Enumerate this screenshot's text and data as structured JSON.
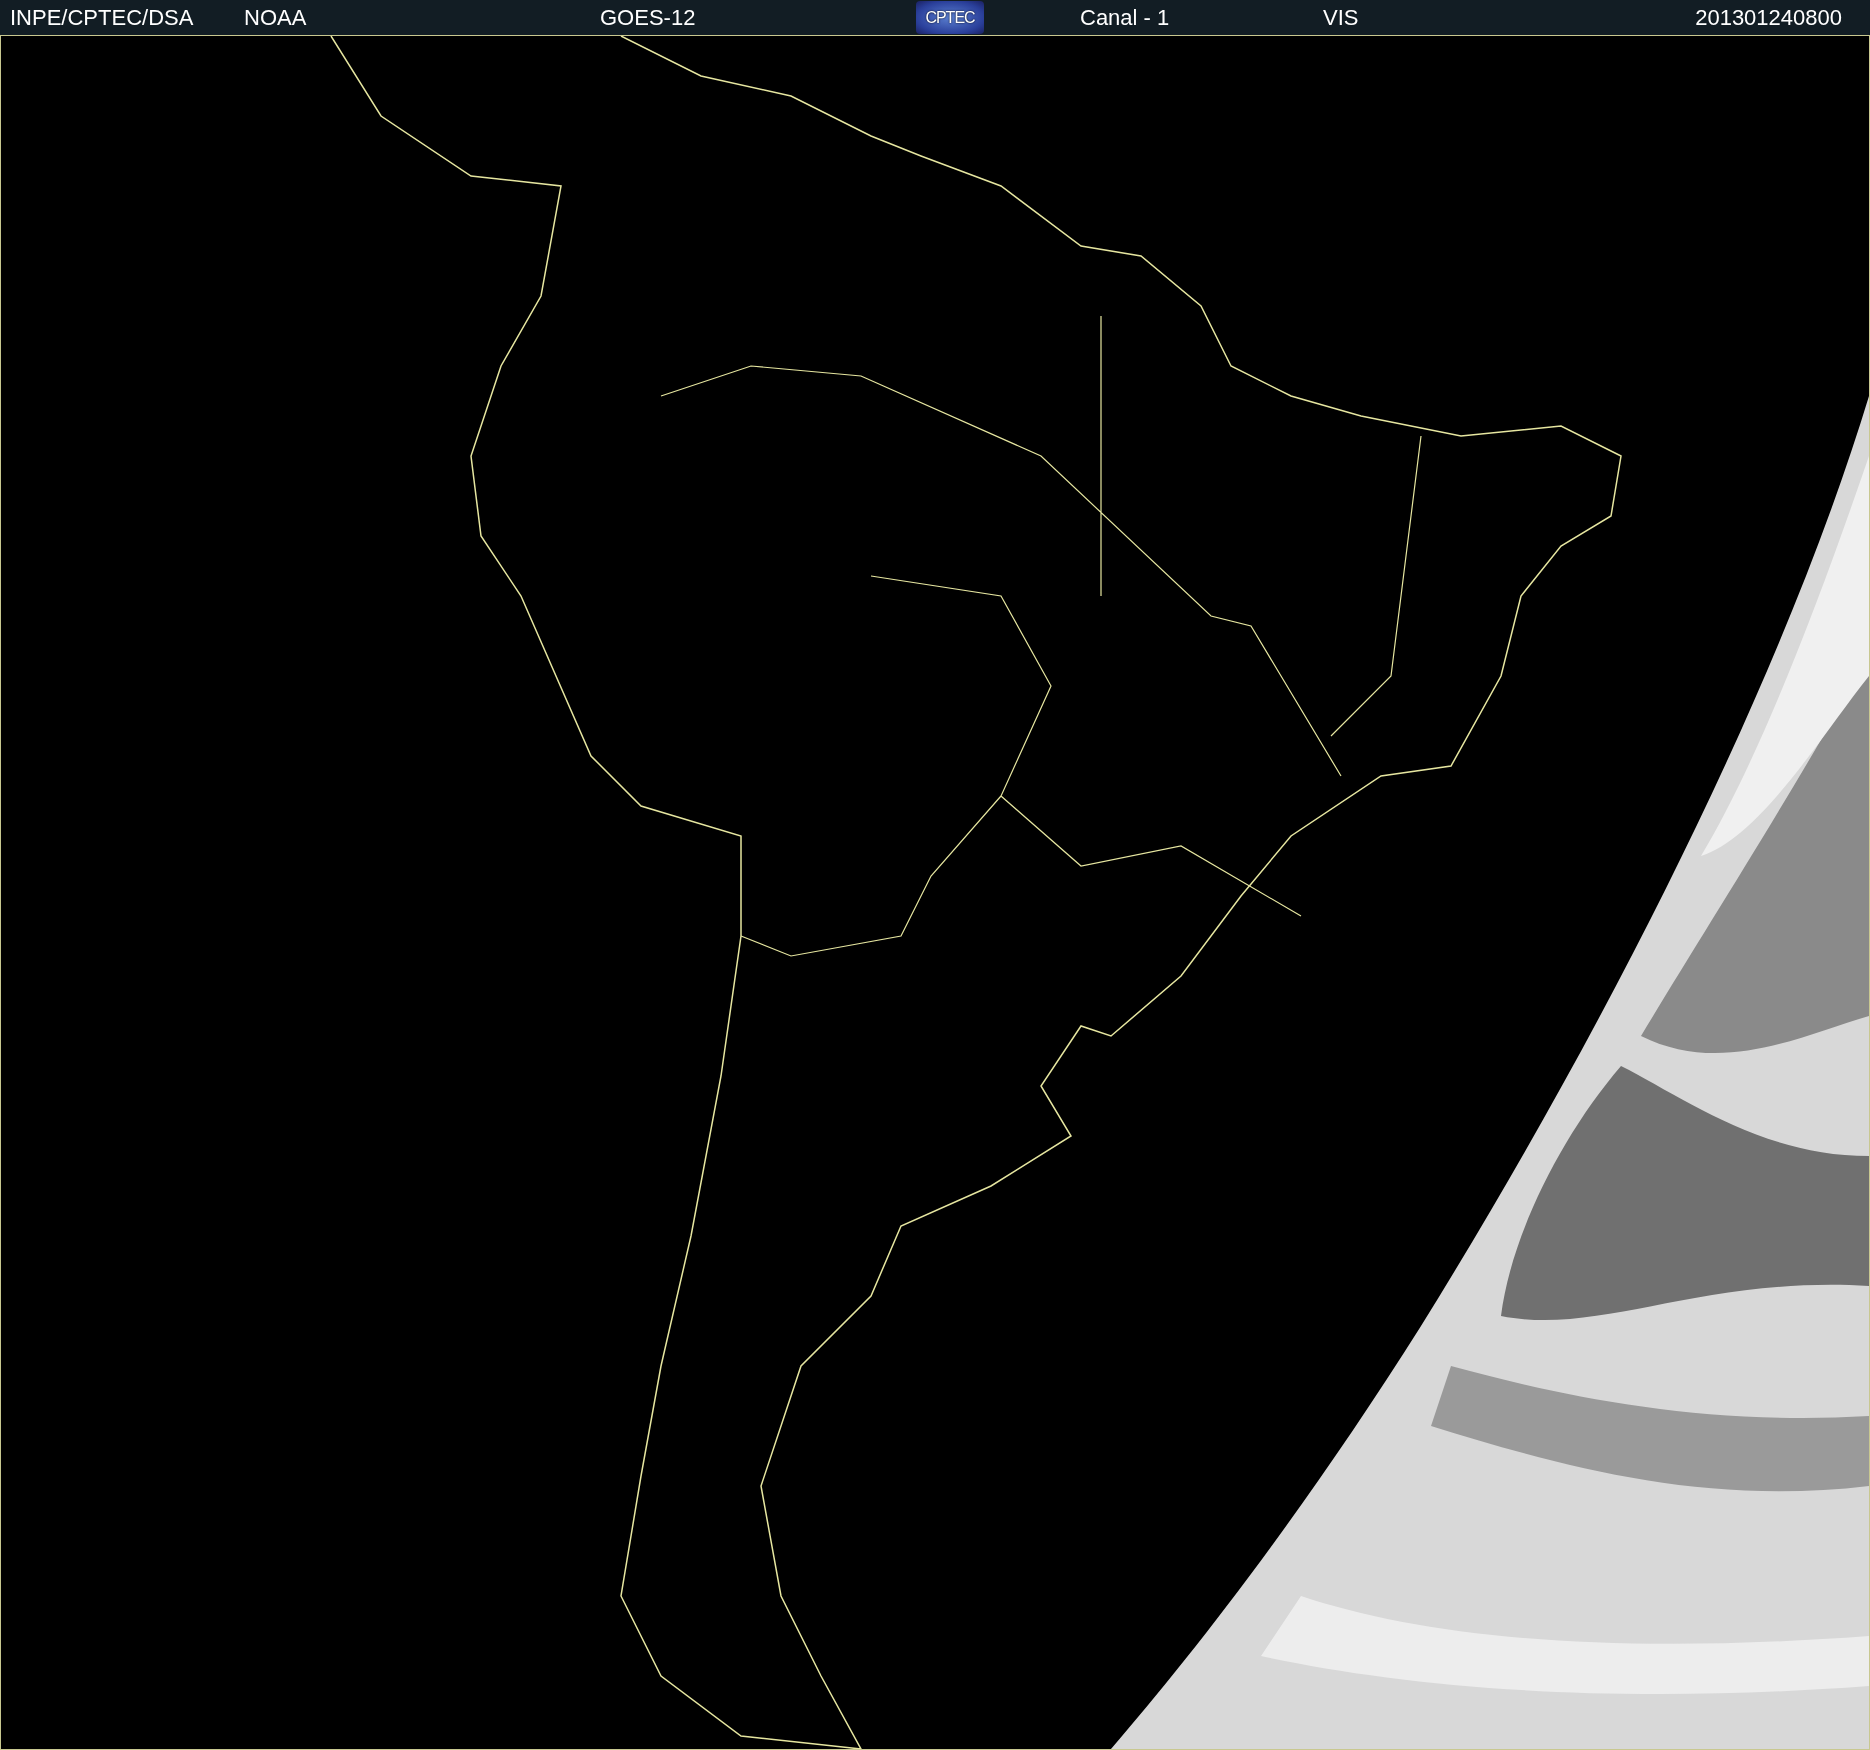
{
  "header": {
    "items": [
      {
        "kind": "text",
        "text": "INPE/CPTEC/DSA"
      },
      {
        "kind": "text",
        "text": "NOAA"
      },
      {
        "kind": "text",
        "text": "GOES-12"
      },
      {
        "kind": "logo",
        "text": "CPTEC"
      },
      {
        "kind": "text",
        "text": "Canal - 1"
      },
      {
        "kind": "text",
        "text": "VIS"
      },
      {
        "kind": "text",
        "text": "201301240800"
      }
    ]
  }
}
